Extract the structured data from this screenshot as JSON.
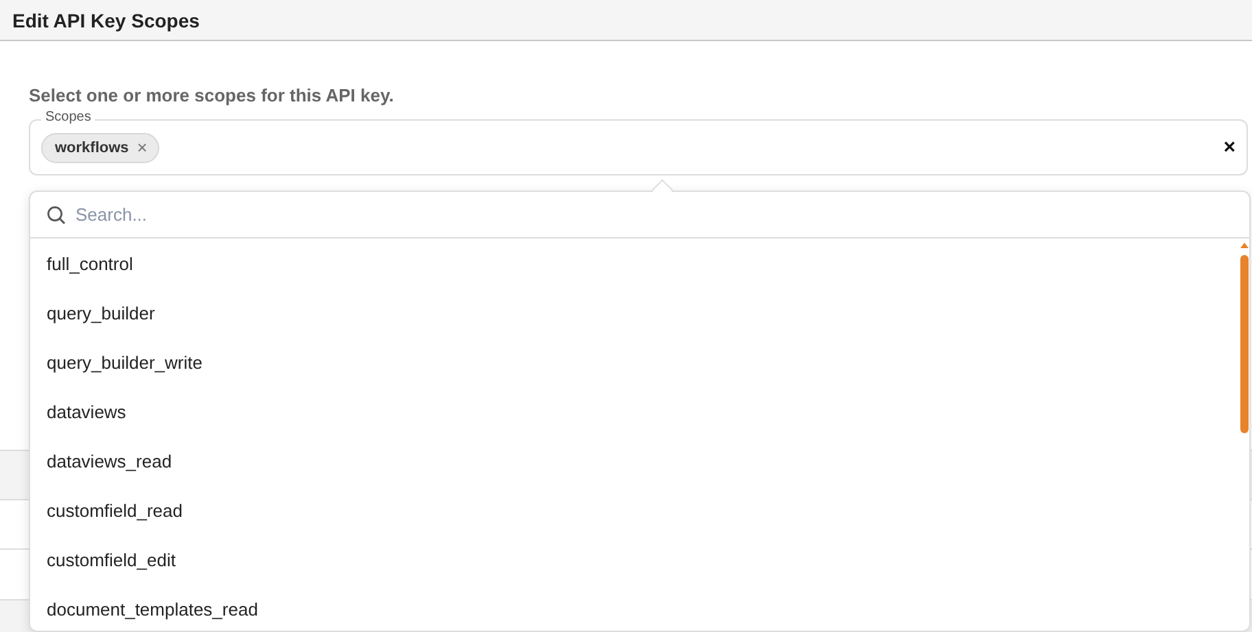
{
  "dialog": {
    "title": "Edit API Key Scopes",
    "instruction": "Select one or more scopes for this API key."
  },
  "scopes_field": {
    "label": "Scopes",
    "chips": [
      {
        "label": "workflows",
        "remove_icon": "×"
      }
    ],
    "clear_icon": "×"
  },
  "dropdown": {
    "search": {
      "placeholder": "Search..."
    },
    "options": [
      {
        "label": "full_control"
      },
      {
        "label": "query_builder"
      },
      {
        "label": "query_builder_write"
      },
      {
        "label": "dataviews"
      },
      {
        "label": "dataviews_read"
      },
      {
        "label": "customfield_read"
      },
      {
        "label": "customfield_edit"
      },
      {
        "label": "document_templates_read"
      }
    ]
  }
}
